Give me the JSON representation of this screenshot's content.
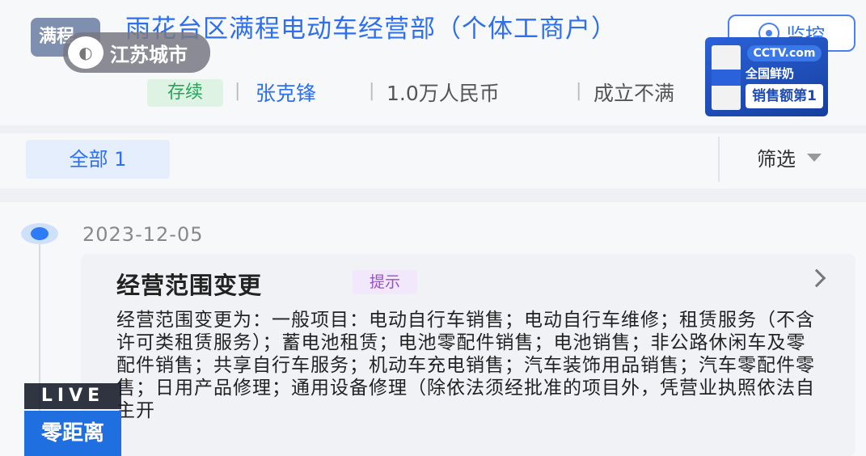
{
  "header": {
    "logo_text": "满程",
    "company_name": "雨花台区满程电动车经营部（个体工商户）",
    "monitor_label": "监控",
    "status": "存续",
    "legal_rep": "张克锋",
    "capital": "1.0万人民币",
    "founded": "成立不满"
  },
  "watermark": {
    "mark": "◐",
    "name": "江苏城市"
  },
  "ad": {
    "cctv": "CCTV.com",
    "line1": "全国鲜奶",
    "line2": "销售额第1"
  },
  "filter": {
    "tab_all": "全部 1",
    "filter_label": "筛选"
  },
  "events": [
    {
      "date": "2023-12-05",
      "title": "经营范围变更",
      "tag": "提示",
      "body": "经营范围变更为：一般项目：电动自行车销售；电动自行车维修；租赁服务（不含许可类租赁服务）；蓄电池租赁；电池零配件销售；电池销售；非公路休闲车及零配件销售；共享自行车服务；机动车充电销售；汽车装饰用品销售；汽车零配件零售；日用产品修理；通用设备修理（除依法须经批准的项目外，凭营业执照依法自主开"
    }
  ],
  "live": {
    "label": "LIVE",
    "program": "零距离"
  },
  "colors": {
    "accent": "#2e6ff0",
    "status_green": "#2aa35a",
    "tag_purple": "#9b4ecb"
  }
}
